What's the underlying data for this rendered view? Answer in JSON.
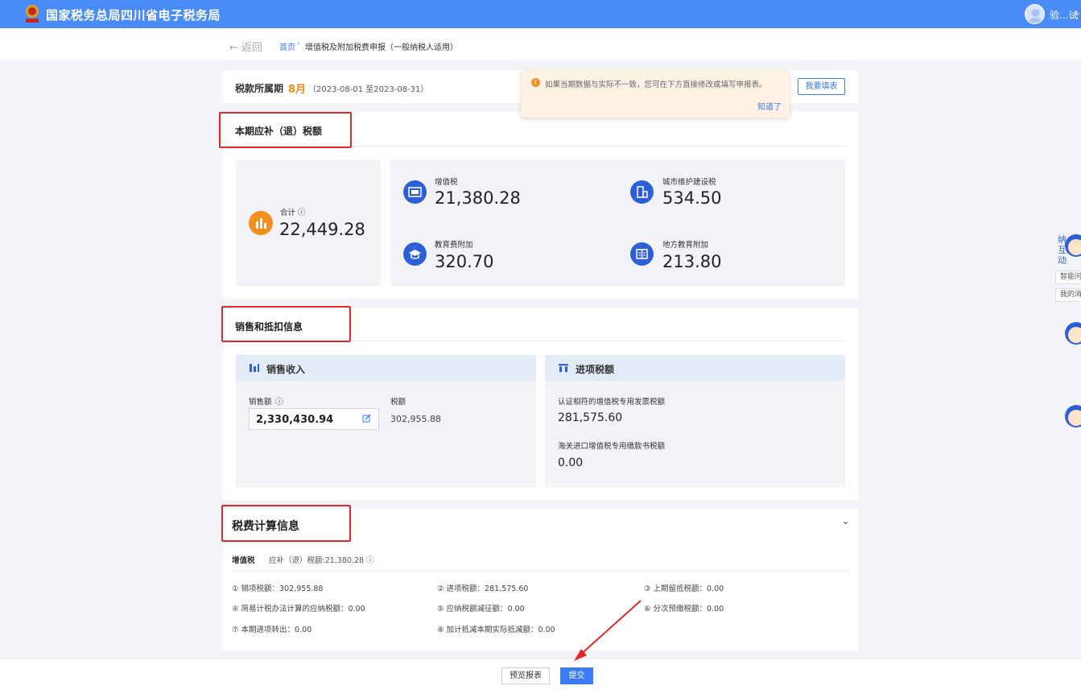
{
  "header": {
    "title": "国家税务总局四川省电子税务局",
    "username": "验...试",
    "brand_color": "#4a8cf7"
  },
  "nav": {
    "back_label": "← 返回",
    "breadcrumb_home": "首页",
    "breadcrumb_sep": "›",
    "breadcrumb_current": "增值税及附加税费申报（一般纳税人适用）"
  },
  "period": {
    "label": "税款所属期",
    "month": "8月",
    "range": "（2023-08-01 至2023-08-31）",
    "fill_button": "我要填表"
  },
  "tip": {
    "icon": "!",
    "text": "如果当期数据与实际不一致，您可在下方直接修改或填写申报表。",
    "ok": "知道了"
  },
  "tax_due": {
    "title": "本期应补（退）税额",
    "total_label": "合计 ⓘ",
    "total_value": "22,449.28",
    "items": [
      {
        "label": "增值税",
        "value": "21,380.28",
        "icon": "tax-ticket-icon"
      },
      {
        "label": "城市维护建设税",
        "value": "534.50",
        "icon": "building-icon"
      },
      {
        "label": "教育费附加",
        "value": "320.70",
        "icon": "graduation-cap-icon"
      },
      {
        "label": "地方教育附加",
        "value": "213.80",
        "icon": "book-icon"
      }
    ]
  },
  "sales": {
    "title": "销售和抵扣信息",
    "sales_income": {
      "title": "销售收入",
      "amount_label": "销售额",
      "amount_info": "ⓘ",
      "amount_value": "2,330,430.94",
      "tax_label": "税额",
      "tax_value": "302,955.88"
    },
    "input_tax": {
      "title": "进项税额",
      "certified_label": "认证相符的增值税专用发票税额",
      "certified_value": "281,575.60",
      "customs_label": "海关进口增值税专用缴款书税额",
      "customs_value": "0.00"
    }
  },
  "calc": {
    "title": "税费计算信息",
    "chevron": "⌄",
    "vat_label": "增值税",
    "vat_due": "应补（退）税额:21,380.28 ⓘ",
    "items": [
      "① 销项税额：302,955.88",
      "② 进项税额：281,575.60",
      "③ 上期留抵税额：0.00",
      "④ 简易计税办法计算的应纳税额：0.00",
      "⑤ 应纳税额减征额：0.00",
      "⑥ 分次预缴税额：0.00",
      "⑦ 本期进项转出：0.00",
      "⑧ 加计抵减本期实际抵减额：0.00"
    ]
  },
  "footer": {
    "preview": "预览报表",
    "submit": "提交"
  },
  "side": {
    "fig_chars": [
      "纳",
      "互",
      "动"
    ],
    "smart_qa": "智能问答",
    "my_msg": "我的消息"
  }
}
